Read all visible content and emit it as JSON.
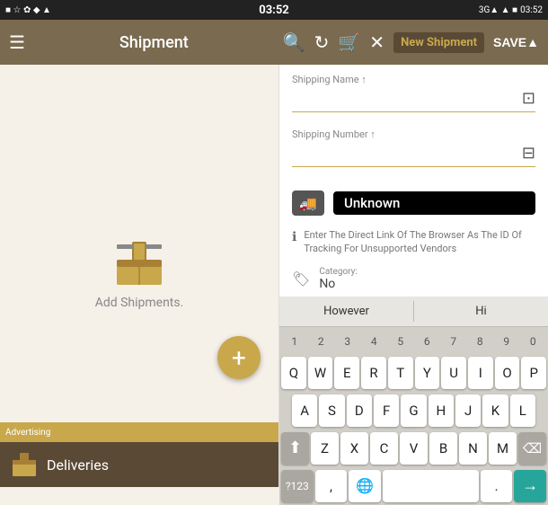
{
  "status_bar": {
    "left_icons": "■ ■ ☆ ✿ ◆ ▲ ● ♦",
    "time": "03:52",
    "right_icons": "■ ▲ 3G▲ ■ ✉"
  },
  "app_bar": {
    "menu_icon": "☰",
    "title": "Shipment",
    "search_icon": "🔍",
    "refresh_icon": "↻",
    "cart_icon": "🛒",
    "close_icon": "✕",
    "new_label": "New Shipment",
    "save_label": "SAVE▲"
  },
  "left_panel": {
    "add_text": "Add Shipments.",
    "ad_label": "Advertising",
    "deliveries_label": "Deliveries",
    "fab_icon": "+"
  },
  "form": {
    "shipping_name_label": "Shipping Name ↑",
    "shipping_number_label": "Shipping Number ↑",
    "tracking_type": "Unknown",
    "info_text": "Enter The Direct Link Of The Browser As The ID Of Tracking For Unsupported Vendors",
    "category_label": "Category:",
    "category_value": "No"
  },
  "keyboard": {
    "suggestion1": "However",
    "suggestion2": "Hi",
    "rows": {
      "numbers": [
        "1",
        "2",
        "3",
        "4",
        "5",
        "6",
        "7",
        "8",
        "9",
        "0"
      ],
      "row1": [
        "Q",
        "W",
        "E",
        "R",
        "T",
        "Y",
        "U",
        "I",
        "O",
        "P"
      ],
      "row2": [
        "A",
        "S",
        "D",
        "F",
        "G",
        "H",
        "J",
        "K",
        "L"
      ],
      "row3": [
        "Z",
        "X",
        "C",
        "V",
        "B",
        "N",
        "M"
      ],
      "bottom": [
        "?123",
        ",",
        "🌐",
        "     ",
        ".",
        "→"
      ]
    }
  }
}
